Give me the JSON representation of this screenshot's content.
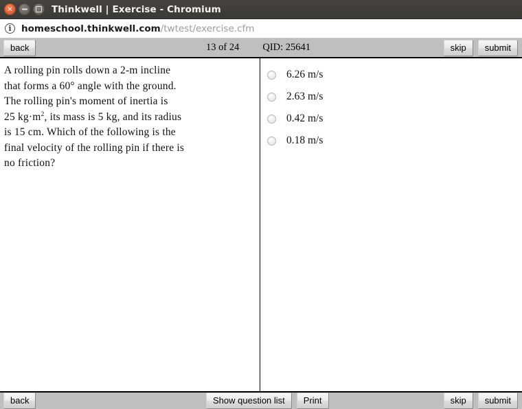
{
  "window": {
    "title": "Thinkwell | Exercise - Chromium",
    "controls": {
      "close_label": "×",
      "minimize_label": "–",
      "maximize_label": "□"
    }
  },
  "address_bar": {
    "info_icon_glyph": "i",
    "url_domain": "homeschool.thinkwell.com",
    "url_path": "/twtest/exercise.cfm"
  },
  "top_toolbar": {
    "back_label": "back",
    "progress_label": "13 of 24",
    "qid_label": "QID: 25641",
    "skip_label": "skip",
    "submit_label": "submit"
  },
  "bottom_toolbar": {
    "back_label": "back",
    "show_question_list_label": "Show question list",
    "print_label": "Print",
    "skip_label": "skip",
    "submit_label": "submit"
  },
  "question": {
    "line1": "A rolling pin rolls down a 2-m incline",
    "line2": "that forms a 60° angle with the ground.",
    "line3": "The rolling pin's moment of inertia is",
    "line4_a": "25 kg·m",
    "line4_sup": "2",
    "line4_b": ", its mass is 5 kg, and its radius",
    "line5": "is 15 cm.  Which of the following is the",
    "line6": "final velocity of the rolling pin if there is",
    "line7": "no friction?"
  },
  "answers": [
    {
      "label": "6.26 m/s",
      "selected": false
    },
    {
      "label": "2.63 m/s",
      "selected": false
    },
    {
      "label": "0.42 m/s",
      "selected": false
    },
    {
      "label": "0.18 m/s",
      "selected": false
    }
  ],
  "colors": {
    "titlebar_bg": "#3b3935",
    "close_button": "#e2623a",
    "toolbar_bg": "#bfbfbf",
    "content_bg": "#ffffff",
    "divider": "#000000"
  }
}
